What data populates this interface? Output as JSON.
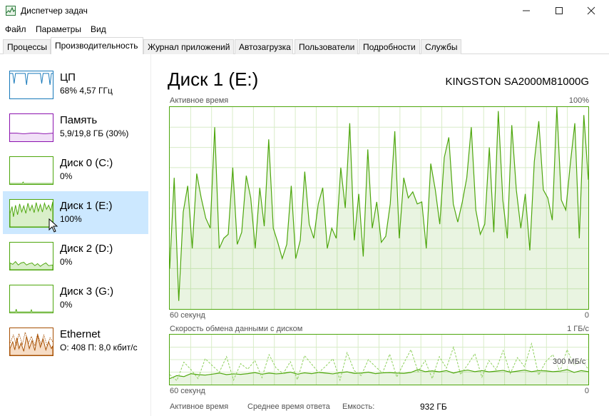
{
  "window": {
    "title": "Диспетчер задач"
  },
  "menu": [
    "Файл",
    "Параметры",
    "Вид"
  ],
  "tabs": [
    "Процессы",
    "Производительность",
    "Журнал приложений",
    "Автозагрузка",
    "Пользователи",
    "Подробности",
    "Службы"
  ],
  "active_tab": 1,
  "devices": [
    {
      "title": "ЦП",
      "sub": "68% 4,57 ГГц",
      "color": "#1779ba"
    },
    {
      "title": "Память",
      "sub": "5,9/19,8 ГБ (30%)",
      "color": "#8b12ae"
    },
    {
      "title": "Диск 0 (C:)",
      "sub": "0%",
      "color": "#4da60c"
    },
    {
      "title": "Диск 1 (E:)",
      "sub": "100%",
      "color": "#4da60c"
    },
    {
      "title": "Диск 2 (D:)",
      "sub": "0%",
      "color": "#4da60c"
    },
    {
      "title": "Диск 3 (G:)",
      "sub": "0%",
      "color": "#4da60c"
    },
    {
      "title": "Ethernet",
      "sub": "О: 408  П: 8,0 кбит/с",
      "color": "#a74f01"
    }
  ],
  "selected_device": 3,
  "detail": {
    "title": "Диск 1 (E:)",
    "model": "KINGSTON SA2000M81000G",
    "active_label": "Активное время",
    "active_max": "100%",
    "time_left": "60 секунд",
    "time_right": "0",
    "transfer_label": "Скорость обмена данными с диском",
    "transfer_max": "1 ГБ/с",
    "transfer_mid": "300 МБ/с",
    "stats": {
      "active_time_label": "Активное время",
      "avg_response_label": "Среднее время ответа",
      "capacity_label": "Емкость:",
      "capacity_value": "932 ГБ"
    }
  },
  "chart_data": [
    {
      "type": "area",
      "title": "Активное время",
      "ylim": [
        0,
        100
      ],
      "values": [
        20,
        65,
        4,
        48,
        61,
        30,
        67,
        55,
        45,
        40,
        90,
        30,
        35,
        37,
        70,
        32,
        38,
        66,
        55,
        30,
        60,
        41,
        84,
        40,
        33,
        25,
        32,
        61,
        25,
        34,
        68,
        42,
        35,
        52,
        60,
        30,
        40,
        35,
        70,
        50,
        92,
        34,
        57,
        26,
        79,
        40,
        53,
        33,
        36,
        52,
        88,
        35,
        65,
        55,
        58,
        52,
        53,
        30,
        72,
        59,
        42,
        75,
        85,
        52,
        43,
        53,
        65,
        90,
        49,
        37,
        42,
        80,
        38,
        98,
        54,
        35,
        91,
        59,
        40,
        57,
        29,
        73,
        93,
        59,
        55,
        44,
        100,
        54,
        49,
        72,
        92,
        35,
        96,
        64
      ]
    },
    {
      "type": "line",
      "title": "Скорость обмена данными с диском",
      "ylim": [
        0,
        1000
      ],
      "series": [
        {
          "name": "",
          "values": [
            120,
            180,
            160,
            220,
            200,
            190,
            210,
            230,
            200,
            215,
            205,
            220,
            240,
            210,
            230,
            215,
            225,
            250,
            210,
            235,
            220,
            245,
            230,
            215,
            240,
            255,
            225,
            230,
            250,
            220,
            235,
            240,
            230,
            225,
            245,
            300,
            260,
            275,
            255,
            280,
            230,
            270,
            290,
            260,
            280,
            255,
            270,
            285,
            250,
            270,
            290,
            260,
            280,
            275,
            260,
            270,
            300,
            245,
            280,
            260
          ]
        },
        {
          "name": "",
          "values": [
            200,
            80,
            450,
            300,
            120,
            520,
            380,
            250,
            560,
            90,
            420,
            310,
            480,
            140,
            600,
            330,
            220,
            460,
            100,
            580,
            410,
            240,
            370,
            520,
            90,
            640,
            280,
            180,
            500,
            360,
            230,
            610,
            150,
            430,
            700,
            260,
            480,
            120,
            560,
            330,
            750,
            200,
            400,
            620,
            150,
            480,
            300,
            680,
            220,
            540,
            360,
            820,
            190,
            460,
            600,
            260,
            700,
            380,
            500,
            310
          ]
        }
      ]
    }
  ]
}
